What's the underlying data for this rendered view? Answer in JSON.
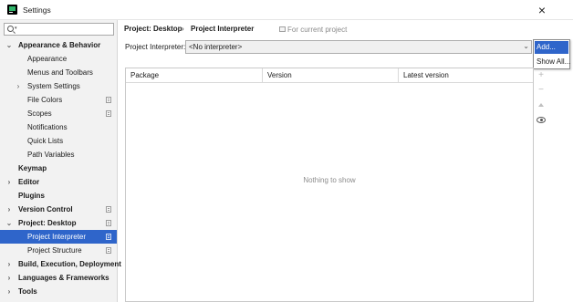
{
  "window": {
    "title": "Settings",
    "close_glyph": "×"
  },
  "search": {
    "value": "",
    "placeholder": ""
  },
  "tree": [
    {
      "label": "Appearance & Behavior",
      "bold": true,
      "expanded": true,
      "arrow": "⌄"
    },
    {
      "label": "Appearance"
    },
    {
      "label": "Menus and Toolbars"
    },
    {
      "label": "System Settings",
      "arrow": "›"
    },
    {
      "label": "File Colors",
      "project_icon": true
    },
    {
      "label": "Scopes",
      "project_icon": true
    },
    {
      "label": "Notifications"
    },
    {
      "label": "Quick Lists"
    },
    {
      "label": "Path Variables"
    },
    {
      "label": "Keymap",
      "bold": true
    },
    {
      "label": "Editor",
      "bold": true,
      "arrow": "›"
    },
    {
      "label": "Plugins",
      "bold": true
    },
    {
      "label": "Version Control",
      "bold": true,
      "arrow": "›",
      "project_icon": true
    },
    {
      "label": "Project: Desktop",
      "bold": true,
      "expanded": true,
      "arrow": "⌄",
      "project_icon": true
    },
    {
      "label": "Project Interpreter",
      "selected": true,
      "project_icon": true
    },
    {
      "label": "Project Structure",
      "project_icon": true
    },
    {
      "label": "Build, Execution, Deployment",
      "bold": true,
      "arrow": "›"
    },
    {
      "label": "Languages & Frameworks",
      "bold": true,
      "arrow": "›"
    },
    {
      "label": "Tools",
      "bold": true,
      "arrow": "›"
    }
  ],
  "breadcrumb": {
    "parent": "Project: Desktop",
    "separator": "›",
    "current": "Project Interpreter",
    "scope_note": "For current project"
  },
  "interpreter": {
    "label": "Project Interpreter:",
    "value": "<No interpreter>",
    "chevron": "⌄"
  },
  "interpreter_menu": {
    "items": [
      "Add...",
      "Show All..."
    ],
    "highlighted": 0
  },
  "packages_table": {
    "columns": [
      "Package",
      "Version",
      "Latest version"
    ],
    "rows": [],
    "empty_text": "Nothing to show"
  },
  "table_toolbar": {
    "add": "+",
    "remove": "−"
  },
  "colors": {
    "selection": "#2f65ca",
    "sidebar_bg": "#f2f2f2"
  }
}
